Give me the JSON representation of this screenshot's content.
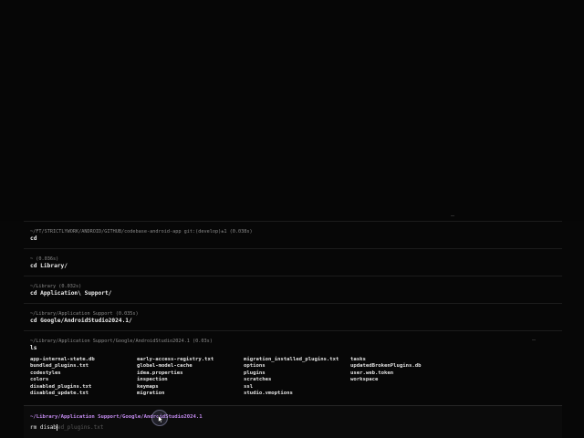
{
  "colors": {
    "background": "#070707",
    "meta_text": "#8a8a8a",
    "command_text": "#f0f0f0",
    "active_path": "#c48bf0",
    "suggestion": "#5a5a5a"
  },
  "blocks": [
    {
      "meta": "~/FT/STRICTLYWORK/ANDROID/GITHUB/codebase-android-app git:(develop)±1 (0.038s)",
      "command": "cd"
    },
    {
      "meta": "~ (0.036s)",
      "command": "cd Library/"
    },
    {
      "meta": "~/Library (0.032s)",
      "command": "cd Application\\ Support/"
    },
    {
      "meta": "~/Library/Application Support (0.035s)",
      "command": "cd Google/AndroidStudio2024.1/"
    },
    {
      "meta": "~/Library/Application Support/Google/AndroidStudio2024.1 (0.03s)",
      "command": "ls"
    }
  ],
  "ls_output": {
    "columns": [
      [
        "app-internal-state.db",
        "bundled_plugins.txt",
        "codestyles",
        "colors",
        "disabled_plugins.txt",
        "disabled_update.txt"
      ],
      [
        "early-access-registry.txt",
        "global-model-cache",
        "idea.properties",
        "inspection",
        "keymaps",
        "migration"
      ],
      [
        "migration_installed_plugins.txt",
        "options",
        "plugins",
        "scratches",
        "ssl",
        "studio.vmoptions"
      ],
      [
        "tasks",
        "updatedBrokenPlugins.db",
        "user.web.token",
        "workspace"
      ]
    ]
  },
  "active_prompt": {
    "path": "~/Library/Application Support/Google/AndroidStudio2024.1",
    "symbol": "rm",
    "typed": "disab",
    "suggestion": "ed_plugins.txt"
  },
  "icons": {
    "pointer": "mouse-pointer-icon"
  }
}
